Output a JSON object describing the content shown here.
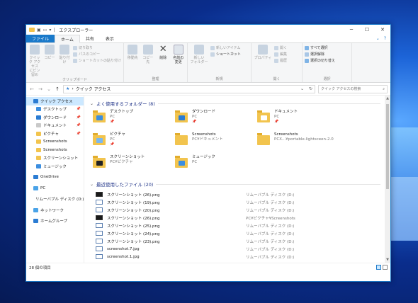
{
  "window": {
    "title": "エクスプローラー",
    "controls": {
      "minimize": "─",
      "maximize": "☐",
      "close": "✕"
    }
  },
  "tabs": {
    "file": "ファイル",
    "home": "ホーム",
    "share": "共有",
    "view": "表示"
  },
  "ribbon": {
    "clipboard": {
      "label": "クリップボード",
      "pin": "クイック アクセス\nにピン留め",
      "copy": "コピー",
      "paste": "貼り付け",
      "cut": "切り取り",
      "copy_path": "パスのコピー",
      "paste_shortcut": "ショートカットの貼り付け"
    },
    "organize": {
      "label": "整理",
      "move": "移動先",
      "copy_to": "コピー先",
      "delete": "削除",
      "rename": "名前の\n変更"
    },
    "new": {
      "label": "新規",
      "new_folder": "新しい\nフォルダー",
      "new_item": "新しいアイテム",
      "shortcut": "ショートカット"
    },
    "open": {
      "label": "開く",
      "properties": "プロパティ",
      "open": "開く",
      "edit": "編集",
      "history": "履歴"
    },
    "select": {
      "label": "選択",
      "select_all": "すべて選択",
      "select_none": "選択解除",
      "invert": "選択の切り替え"
    }
  },
  "address": {
    "path": "クイック アクセス",
    "search_placeholder": "クイック アクセスの検索"
  },
  "nav": [
    {
      "label": "クイック アクセス",
      "level": 0,
      "color": "#2b7cd3",
      "selected": true,
      "pin": ""
    },
    {
      "label": "デスクトップ",
      "level": 1,
      "color": "#3b8ee0",
      "pin": "📌"
    },
    {
      "label": "ダウンロード",
      "level": 1,
      "color": "#2b7cd3",
      "pin": "📌"
    },
    {
      "label": "ドキュメント",
      "level": 1,
      "color": "#c9c9c9",
      "pin": "📌"
    },
    {
      "label": "ピクチャ",
      "level": 1,
      "color": "#f2c44e",
      "pin": "📌"
    },
    {
      "label": "Screenshots",
      "level": 1,
      "color": "#f2c44e",
      "pin": ""
    },
    {
      "label": "Screenshots",
      "level": 1,
      "color": "#f2c44e",
      "pin": ""
    },
    {
      "label": "スクリーンショット",
      "level": 1,
      "color": "#f2c44e",
      "pin": ""
    },
    {
      "label": "ミュージック",
      "level": 1,
      "color": "#3b8ee0",
      "pin": ""
    },
    {
      "label": "",
      "level": 0,
      "gap": true
    },
    {
      "label": "OneDrive",
      "level": 0,
      "color": "#2b7cd3",
      "pin": ""
    },
    {
      "label": "",
      "level": 0,
      "gap": true
    },
    {
      "label": "PC",
      "level": 0,
      "color": "#4aa3e8",
      "pin": ""
    },
    {
      "label": "",
      "level": 0,
      "gap": true
    },
    {
      "label": "リムーバブル ディスク (D:)",
      "level": 0,
      "color": "#888888",
      "pin": ""
    },
    {
      "label": "",
      "level": 0,
      "gap": true
    },
    {
      "label": "ネットワーク",
      "level": 0,
      "color": "#4aa3e8",
      "pin": ""
    },
    {
      "label": "",
      "level": 0,
      "gap": true
    },
    {
      "label": "ホームグループ",
      "level": 0,
      "color": "#2b7cd3",
      "pin": ""
    }
  ],
  "frequent": {
    "header": "よく使用するフォルダー (8)",
    "folders": [
      {
        "name": "デスクトップ",
        "loc": "PC",
        "pin": "📌",
        "badge": "#3b8ee0"
      },
      {
        "name": "ダウンロード",
        "loc": "PC",
        "pin": "📌",
        "badge": "#2b7cd3"
      },
      {
        "name": "ドキュメント",
        "loc": "PC",
        "pin": "📌",
        "badge": "#ffffff"
      },
      {
        "name": "ピクチャ",
        "loc": "PC",
        "pin": "📌",
        "badge": "#7ab8f0"
      },
      {
        "name": "Screenshots",
        "loc": "PC¥ドキュメント",
        "pin": "",
        "badge": ""
      },
      {
        "name": "Screenshots",
        "loc": "PCX...¥portable-lightsceen-2.0",
        "pin": "",
        "badge": ""
      },
      {
        "name": "スクリーンショット",
        "loc": "PC¥ピクチャ",
        "pin": "",
        "badge": "#222222"
      },
      {
        "name": "ミュージック",
        "loc": "PC",
        "pin": "",
        "badge": "#3b8ee0"
      }
    ]
  },
  "recent": {
    "header": "最近使用したファイル (20)",
    "files": [
      {
        "name": "スクリーンショット (26).png",
        "loc": "リムーバブル ディスク (D:)",
        "dark": true
      },
      {
        "name": "スクリーンショット (19).png",
        "loc": "リムーバブル ディスク (D:)",
        "dark": false
      },
      {
        "name": "スクリーンショット (20).png",
        "loc": "リムーバブル ディスク (D:)",
        "dark": false
      },
      {
        "name": "スクリーンショット (26).png",
        "loc": "PC¥ピクチャ¥Screenshots",
        "dark": true
      },
      {
        "name": "スクリーンショット (25).png",
        "loc": "リムーバブル ディスク (D:)",
        "dark": false
      },
      {
        "name": "スクリーンショット (24).png",
        "loc": "リムーバブル ディスク (D:)",
        "dark": false
      },
      {
        "name": "スクリーンショット (23).png",
        "loc": "リムーバブル ディスク (D:)",
        "dark": false
      },
      {
        "name": "screenshot.7.jpg",
        "loc": "リムーバブル ディスク (D:)",
        "dark": false
      },
      {
        "name": "screenshot.1.jpg",
        "loc": "リムーバブル ディスク (D:)",
        "dark": false
      }
    ]
  },
  "status": {
    "count": "28 個の項目"
  }
}
